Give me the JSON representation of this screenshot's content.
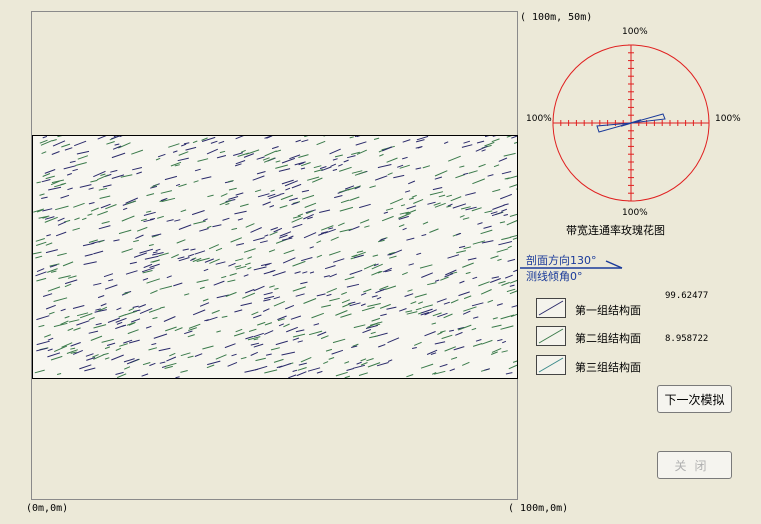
{
  "plot": {
    "coord_top_right": "( 100m, 50m)",
    "coord_bottom_left": "(0m,0m)",
    "coord_bottom_right": "( 100m,0m)"
  },
  "rose": {
    "title": "带宽连通率玫瑰花图",
    "label_top": "100%",
    "label_bottom": "100%",
    "label_left": "100%",
    "label_right": "100%"
  },
  "profile": {
    "direction": "剖面方向130°",
    "dip": "测线倾角0°"
  },
  "legend": [
    {
      "label": "第一组结构面",
      "value": "99.62477",
      "color": "#2a2a6a"
    },
    {
      "label": "第二组结构面",
      "value": "8.958722",
      "color": "#3a7a4a"
    },
    {
      "label": "第三组结构面",
      "value": "",
      "color": "#3a8a8a"
    }
  ],
  "buttons": {
    "next": "下一次模拟",
    "close": "关闭"
  },
  "colors": {
    "rose_circle": "#e02020",
    "set1": "#2a2a6a",
    "set2": "#3a7a4a",
    "profile_arrow": "#1a3a9a"
  }
}
